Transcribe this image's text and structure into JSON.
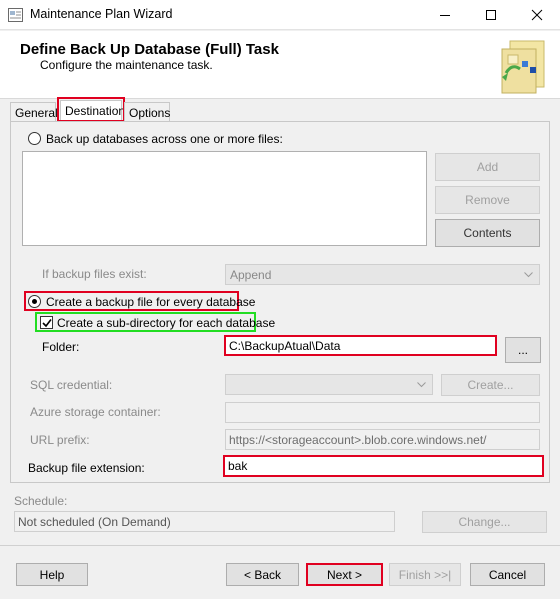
{
  "window": {
    "title": "Maintenance Plan Wizard"
  },
  "header": {
    "title": "Define Back Up Database (Full) Task",
    "subtitle": "Configure the maintenance task."
  },
  "tabs": [
    {
      "label": "General"
    },
    {
      "label": "Destination"
    },
    {
      "label": "Options"
    }
  ],
  "destination": {
    "backup_across_files_label": "Back up databases across one or more files:",
    "add_label": "Add",
    "remove_label": "Remove",
    "contents_label": "Contents",
    "if_exist_label": "If backup files exist:",
    "if_exist_value": "Append",
    "create_file_label": "Create a backup file for every database",
    "create_subdir_label": "Create a sub-directory for each database",
    "folder_label": "Folder:",
    "folder_value": "C:\\BackupAtual\\Data",
    "browse_label": "...",
    "sql_credential_label": "SQL credential:",
    "sql_credential_value": "",
    "create_label": "Create...",
    "azure_container_label": "Azure storage container:",
    "azure_container_value": "",
    "url_prefix_label": "URL prefix:",
    "url_prefix_value": "https://<storageaccount>.blob.core.windows.net/",
    "extension_label": "Backup file extension:",
    "extension_value": "bak"
  },
  "schedule": {
    "label": "Schedule:",
    "value": "Not scheduled (On Demand)",
    "change_label": "Change..."
  },
  "footer": {
    "help_label": "Help",
    "back_label": "< Back",
    "next_label": "Next >",
    "finish_label": "Finish >>|",
    "cancel_label": "Cancel"
  },
  "colors": {
    "highlight_red": "#e00020",
    "highlight_green": "#22dd22"
  }
}
